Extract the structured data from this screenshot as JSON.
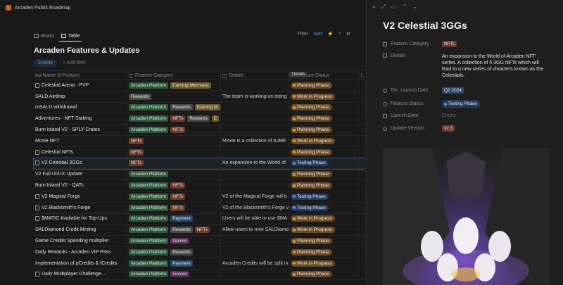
{
  "app": {
    "title": "Arcaden Public Roadmap"
  },
  "views": {
    "board": "Board",
    "table": "Table"
  },
  "toolbar": {
    "filter": "Filter",
    "sort": "Sort"
  },
  "page": {
    "title": "Arcaden Features & Updates",
    "menu": "···"
  },
  "filters": {
    "sorts": "3 sorts",
    "add_filter": "+ Add filter"
  },
  "columns": {
    "name": "Aa Name of Feature",
    "category": "Feature Category",
    "details": "Details",
    "status": "Feature Status",
    "extra": "L"
  },
  "details_tooltip": "Details",
  "rows": [
    {
      "name": "Celestial Arena - PVP",
      "icon": true,
      "tags": [
        "Arcaden Platform",
        "Earning Mechanic"
      ],
      "details": "",
      "status": "Planning Phase"
    },
    {
      "name": "SALD Airdrop",
      "icon": false,
      "tags": [
        "Rewards"
      ],
      "details": "The team is working on doing",
      "status": "Work in Progress"
    },
    {
      "name": "mSALD withdrawal",
      "icon": false,
      "tags": [
        "Arcaden Platform",
        "Rewards",
        "Earning M"
      ],
      "details": "",
      "status": "Planning Phase"
    },
    {
      "name": "Adventures - NFT Staking",
      "icon": false,
      "tags": [
        "Arcaden Platform",
        "NFTs",
        "Rewards",
        "E"
      ],
      "details": "",
      "status": "Planning Phase"
    },
    {
      "name": "Burn Island V2 - SPLY Crates",
      "icon": false,
      "tags": [
        "Arcaden Platform",
        "NFTs"
      ],
      "details": "",
      "status": "Planning Phase"
    },
    {
      "name": "Moxie NFT",
      "icon": false,
      "tags": [
        "NFTs"
      ],
      "details": "Moxie is a collection of 8,888",
      "status": "Work in Progress"
    },
    {
      "name": "Celestial NFTs",
      "icon": true,
      "tags": [
        "NFTs"
      ],
      "details": "",
      "status": "Planning Phase"
    },
    {
      "name": "V2 Celestial 3GGs",
      "icon": true,
      "tags": [
        "NFTs"
      ],
      "details": "An expansion to the World of",
      "status": "Testing Phase"
    },
    {
      "name": "V2 Full UI/UX Update",
      "icon": false,
      "tags": [
        "Arcaden Platform"
      ],
      "details": "",
      "status": "Planning Phase"
    },
    {
      "name": "Burn Island V2 - QATs",
      "icon": false,
      "tags": [
        "Arcaden Platform",
        "NFTs"
      ],
      "details": "",
      "status": "Planning Phase"
    },
    {
      "name": "V2 Magical Forge",
      "icon": true,
      "tags": [
        "Arcaden Platform",
        "NFTs"
      ],
      "details": "V2 of the Magical Forge will b",
      "status": "Testing Phase"
    },
    {
      "name": "V2 Blacksmith's Forge",
      "icon": true,
      "tags": [
        "Arcaden Platform",
        "NFTs"
      ],
      "details": "V2 of the Blacksmith's Forge v",
      "status": "Testing Phase"
    },
    {
      "name": "$MATIC Available for Top-Ups",
      "icon": true,
      "tags": [
        "Arcaden Platform",
        "Payment"
      ],
      "details": "Users will be able to use $MA",
      "status": "Work in Progress"
    },
    {
      "name": "SALDiamond Credit Minting",
      "icon": false,
      "tags": [
        "Arcaden Platform",
        "Rewards",
        "NFTs"
      ],
      "details": "Allow users to mint SALDiamo",
      "status": "Work in Progress"
    },
    {
      "name": "Game Credits Spending multiplier",
      "icon": false,
      "tags": [
        "Arcaden Platform",
        "Games"
      ],
      "details": "",
      "status": "Planning Phase"
    },
    {
      "name": "Daily Rewards - Arcaden VIP Pass",
      "icon": false,
      "tags": [
        "Arcaden Platform",
        "Rewards"
      ],
      "details": "",
      "status": "Planning Phase"
    },
    {
      "name": "Implementation of pCredits & fCredits",
      "icon": false,
      "tags": [
        "Arcaden Platform",
        "Payment"
      ],
      "details": "Arcaden Credits will be split in",
      "status": "Work in Progress"
    },
    {
      "name": "Daily Multiplayer Challenge...",
      "icon": true,
      "tags": [
        "Arcaden Platform",
        "Games"
      ],
      "details": "",
      "status": "Planning Phase"
    }
  ],
  "selected_row": 7,
  "tag_colors": {
    "Arcaden Platform": "#2b5a3a",
    "Earning Mechanic": "#6b5a2a",
    "Earning M": "#6b5a2a",
    "E": "#6b5a2a",
    "Rewards": "#4a4a4a",
    "NFTs": "#6b3a2a",
    "Payment": "#2a4a6b",
    "Games": "#5a2f56"
  },
  "status_colors": {
    "Planning Phase": {
      "bg": "#6b4a23",
      "dot": "#d4a04a"
    },
    "Work in Progress": {
      "bg": "#6b4a23",
      "dot": "#d4a04a"
    },
    "Testing Phase": {
      "bg": "#233a5c",
      "dot": "#5b9bd5"
    }
  },
  "panel": {
    "title": "V2 Celestial 3GGs",
    "props": {
      "category_label": "Feature Category",
      "category_value": "NFTs",
      "details_label": "Details",
      "details_value": "An expansion to the World of Arcaden NFT series. A collection of 5 3GG NFTs which will lead to a new series of chracters known as the Celestials.",
      "launch_est_label": "Est. Launch Date",
      "launch_est_value": "Q2 2024",
      "status_label": "Feature Status",
      "status_value": "Testing Phase",
      "launch_label": "Launch Date",
      "launch_value": "Empty",
      "version_label": "Update Version",
      "version_value": "v2.3"
    }
  }
}
